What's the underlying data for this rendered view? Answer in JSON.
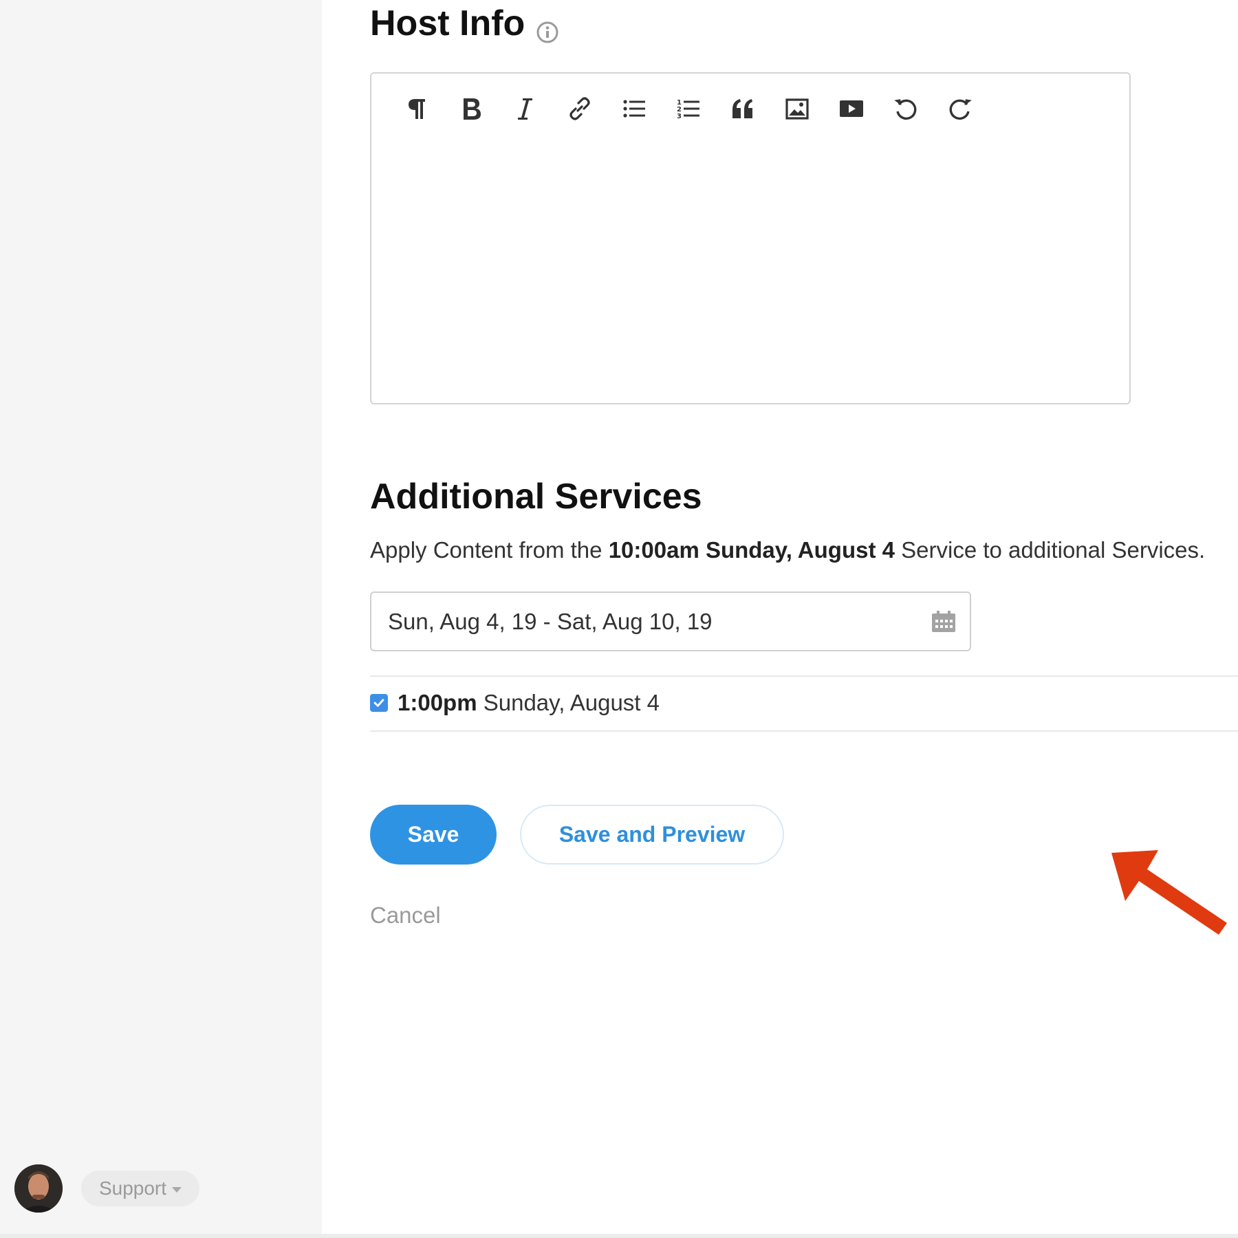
{
  "sidebar": {
    "support_label": "Support"
  },
  "host_info": {
    "title": "Host Info",
    "toolbar": [
      {
        "name": "paragraph-icon"
      },
      {
        "name": "bold-icon"
      },
      {
        "name": "italic-icon"
      },
      {
        "name": "link-icon"
      },
      {
        "name": "bullet-list-icon"
      },
      {
        "name": "numbered-list-icon"
      },
      {
        "name": "quote-icon"
      },
      {
        "name": "image-icon"
      },
      {
        "name": "video-icon"
      },
      {
        "name": "undo-icon"
      },
      {
        "name": "redo-icon"
      }
    ]
  },
  "additional_services": {
    "title": "Additional Services",
    "apply_prefix": "Apply Content from the ",
    "apply_bold": "10:00am Sunday, August 4",
    "apply_suffix": " Service to additional Services.",
    "date_range": "Sun, Aug 4, 19 - Sat, Aug 10, 19",
    "services": [
      {
        "time": "1:00pm",
        "date": " Sunday, August 4",
        "checked": true
      }
    ]
  },
  "actions": {
    "save_label": "Save",
    "save_preview_label": "Save and Preview",
    "cancel_label": "Cancel"
  },
  "colors": {
    "primary": "#2f93e4",
    "annotation_arrow": "#e03a10"
  }
}
